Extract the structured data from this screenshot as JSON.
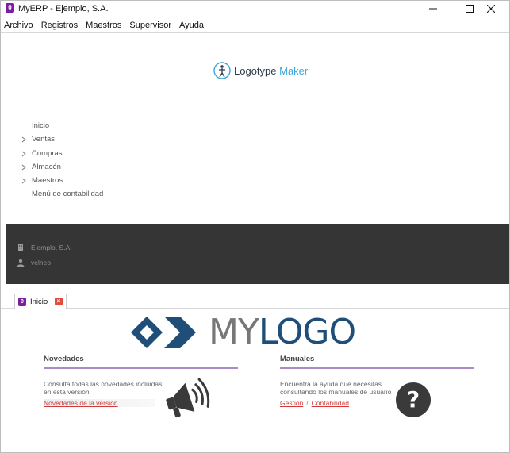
{
  "window": {
    "title": "MyERP - Ejemplo, S.A.",
    "icon": "app-logo-icon",
    "controls": [
      "minimize-icon",
      "maximize-icon",
      "close-icon"
    ]
  },
  "menubar": {
    "items": [
      {
        "label": "Archivo"
      },
      {
        "label": "Registros"
      },
      {
        "label": "Maestros"
      },
      {
        "label": "Supervisor"
      },
      {
        "label": "Ayuda"
      }
    ]
  },
  "sidebar": {
    "logo": {
      "word1": "Logotype",
      "word2": "Maker"
    },
    "nav": [
      {
        "label": "Inicio",
        "expandable": false
      },
      {
        "label": "Ventas",
        "expandable": true
      },
      {
        "label": "Compras",
        "expandable": true
      },
      {
        "label": "Almacén",
        "expandable": true
      },
      {
        "label": "Maestros",
        "expandable": true
      },
      {
        "label": "Menú de contabilidad",
        "expandable": false
      }
    ],
    "company": "Ejemplo, S.A.",
    "user": "velneo"
  },
  "tabs": [
    {
      "label": "Inicio",
      "icon": "app-logo-icon",
      "closable": true
    }
  ],
  "content": {
    "banner": {
      "part1": "MY",
      "part2": "LOGO"
    },
    "novedades": {
      "title": "Novedades",
      "description": "Consulta todas las novedades incluidas en esta versión",
      "link": "Novedades de la versión",
      "icon": "megaphone-icon"
    },
    "manuales": {
      "title": "Manuales",
      "description": "Encuentra la ayuda que necesitas consultando los manuales de usuario",
      "link1": "Gestión",
      "separator": "/",
      "link2": "Contabilidad",
      "icon": "help-icon"
    }
  },
  "colors": {
    "accent_purple": "#7b1fa2",
    "dark_panel": "#353535",
    "link_red": "#d23b3b",
    "logo_blue": "#1f4e79",
    "section_rule": "#a98cc7"
  }
}
